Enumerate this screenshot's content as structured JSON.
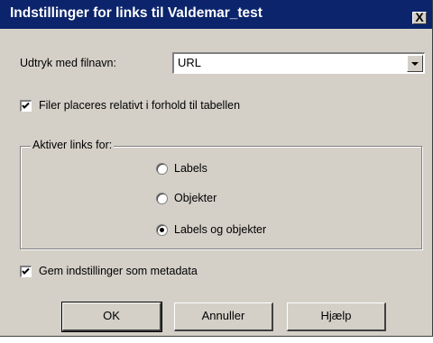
{
  "window": {
    "title": "Indstillinger for links til Valdemar_test",
    "close_symbol": "X"
  },
  "expression": {
    "label": "Udtryk med filnavn:",
    "value": "URL"
  },
  "relative_checkbox": {
    "label": "Filer placeres relativt i forhold til tabellen",
    "checked": true
  },
  "links_group": {
    "legend": "Aktiver links for:",
    "options": [
      {
        "label": "Labels",
        "selected": false
      },
      {
        "label": "Objekter",
        "selected": false
      },
      {
        "label": "Labels og objekter",
        "selected": true
      }
    ]
  },
  "metadata_checkbox": {
    "label": "Gem indstillinger som metadata",
    "checked": true
  },
  "buttons": {
    "ok": "OK",
    "cancel": "Annuller",
    "help": "Hjælp"
  }
}
